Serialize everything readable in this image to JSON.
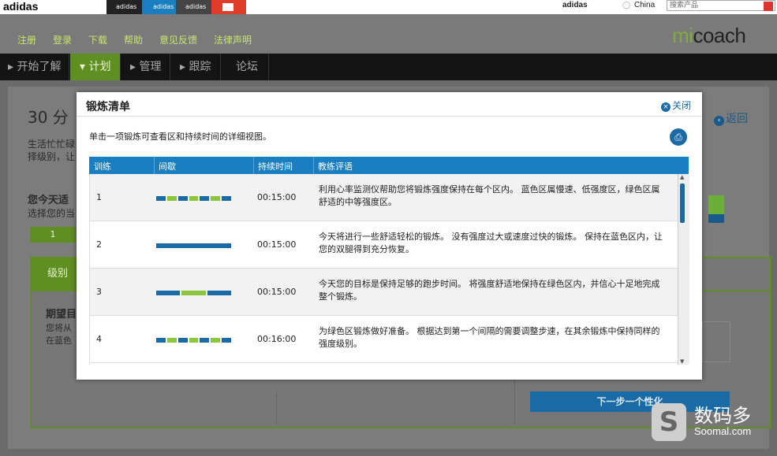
{
  "brand": {
    "logo_text": "adidas",
    "tabs": [
      {
        "label": "adidas",
        "bg": "#222222"
      },
      {
        "label": "adidas",
        "bg": "#1a7fc1"
      },
      {
        "label": "adidas",
        "bg": "#444444"
      },
      {
        "label": "",
        "bg": "#e03c2a"
      }
    ],
    "logo_small": "adidas",
    "region": "China",
    "search_placeholder": "搜索产品"
  },
  "header": {
    "links": [
      "注册",
      "登录",
      "下载",
      "帮助",
      "意见反馈",
      "法律声明"
    ],
    "logo_mi": "mi",
    "logo_coach": "coach"
  },
  "nav": {
    "items": [
      {
        "label": "开始了解",
        "active": false
      },
      {
        "label": "计划",
        "active": true
      },
      {
        "label": "管理",
        "active": false
      },
      {
        "label": "跟踪",
        "active": false
      },
      {
        "label": "论坛",
        "active": false
      }
    ]
  },
  "background": {
    "heading": "30 分",
    "desc_lines": [
      "生活忙忙碌",
      "择级别，让"
    ],
    "today_title": "您今天适",
    "today_sub": "选择您的当",
    "step_one": "1",
    "level_tab": "级别",
    "expect_title": "期望目",
    "expect_lines": [
      "您将从",
      "在蓝色"
    ],
    "back_label": "返回",
    "next_button": "下一步一个性化"
  },
  "modal": {
    "title": "锻炼清单",
    "close_label": "关闭",
    "instruction": "单击一项锻炼可查看区和持续时间的详细视图。",
    "columns": [
      "训练",
      "间歇",
      "持续时间",
      "教练评语"
    ],
    "rows": [
      {
        "num": "1",
        "duration": "00:15:00",
        "comment": "利用心率监测仪帮助您将锻炼强度保持在每个区内。 蓝色区属慢速、低强度区，绿色区属舒适的中等强度区。",
        "segments": [
          "blue",
          "green",
          "blue",
          "green",
          "blue",
          "green",
          "blue"
        ]
      },
      {
        "num": "2",
        "duration": "00:15:00",
        "comment": "今天将进行一些舒适轻松的锻炼。 没有强度过大或速度过快的锻炼。 保持在蓝色区内，让您的双腿得到充分恢复。",
        "segments": [
          "blue"
        ]
      },
      {
        "num": "3",
        "duration": "00:15:00",
        "comment": "今天您的目标是保持足够的跑步时间。 将强度舒适地保持在绿色区内，并信心十足地完成整个锻炼。",
        "segments": [
          "blue",
          "green",
          "blue"
        ]
      },
      {
        "num": "4",
        "duration": "00:16:00",
        "comment": "为绿色区锻炼做好准备。 根据达到第一个间隔的需要调整步速，在其余锻炼中保持同样的强度级别。",
        "segments": [
          "blue",
          "green",
          "blue",
          "green",
          "blue",
          "green",
          "blue"
        ]
      }
    ]
  },
  "colors": {
    "zone_blue": "#1a6aa5",
    "zone_green": "#8cc63f",
    "accent_green": "#7cb22f",
    "header_blue": "#1a7fc1"
  },
  "watermark": {
    "cn": "数码多",
    "en": "Soomal.com"
  }
}
